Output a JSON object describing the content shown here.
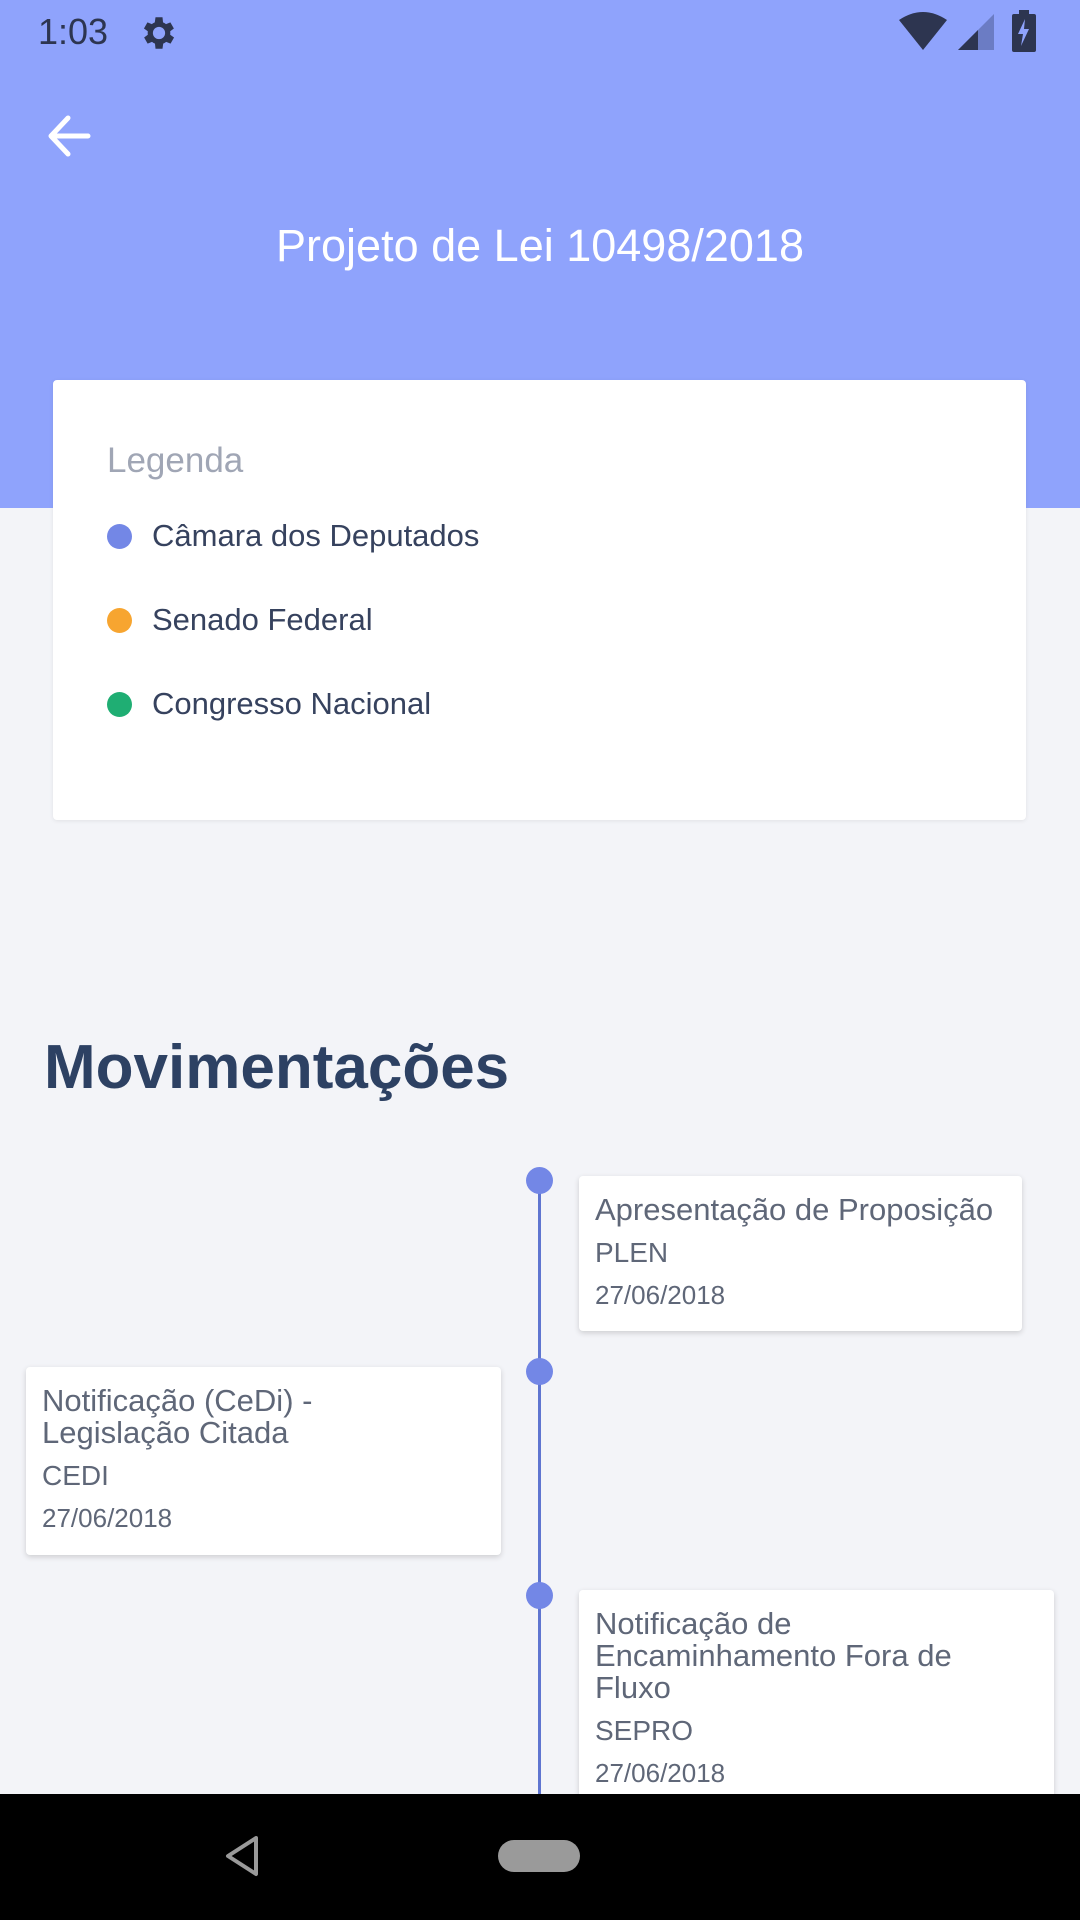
{
  "status_bar": {
    "time": "1:03",
    "icons": [
      "gear-icon",
      "wifi-icon",
      "signal-icon",
      "battery-icon"
    ]
  },
  "app_bar": {
    "title": "Projeto de Lei 10498/2018",
    "back_icon": "arrow-left-icon"
  },
  "colors": {
    "header": "#8fa3fc",
    "camara": "#7387e6",
    "senado": "#f7a530",
    "congresso": "#1fae73"
  },
  "legend": {
    "title": "Legenda",
    "items": [
      {
        "label": "Câmara dos Deputados",
        "color": "#7387e6"
      },
      {
        "label": "Senado Federal",
        "color": "#f7a530"
      },
      {
        "label": "Congresso Nacional",
        "color": "#1fae73"
      }
    ]
  },
  "movimentacoes": {
    "title": "Movimentações",
    "events": [
      {
        "title": "Apresentação de Proposição",
        "org": "PLEN",
        "date": "27/06/2018"
      },
      {
        "title": "Notificação (CeDi) - Legislação Citada",
        "org": "CEDI",
        "date": "27/06/2018"
      },
      {
        "title": "Notificação de Encaminhamento Fora de Fluxo",
        "org": "SEPRO",
        "date": "27/06/2018"
      }
    ]
  },
  "nav_bar": {
    "icons": [
      "nav-back-icon",
      "home-pill-icon"
    ]
  }
}
